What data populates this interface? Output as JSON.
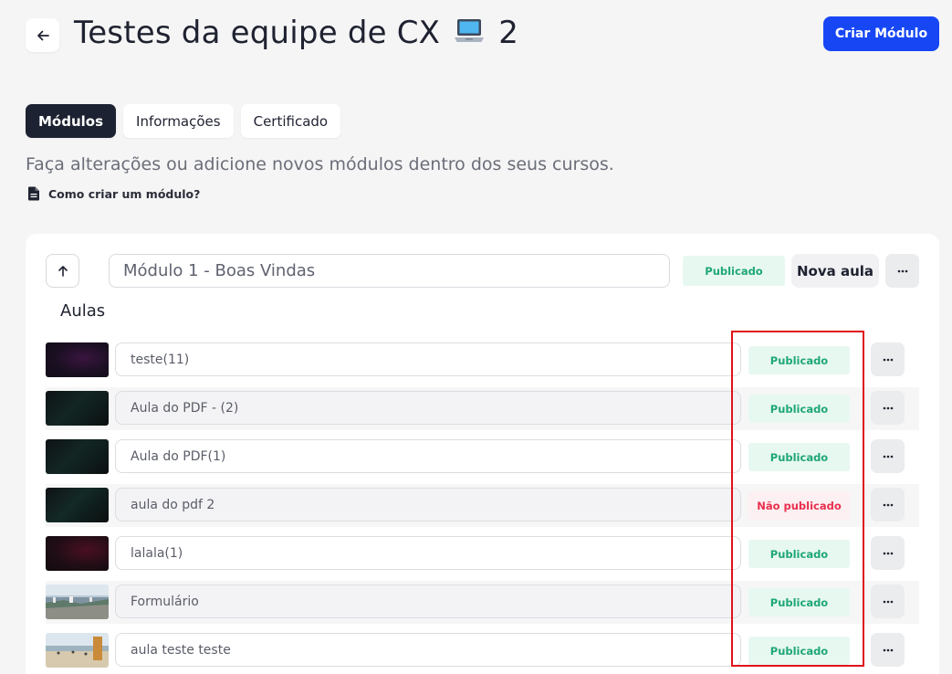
{
  "header": {
    "back_icon": "arrow-left-icon",
    "title_prefix": "Testes da equipe de CX",
    "title_emoji": "laptop-icon",
    "title_suffix": "2",
    "create_module_label": "Criar Módulo",
    "accent_color": "#1747f5"
  },
  "tabs": [
    {
      "label": "Módulos",
      "active": true
    },
    {
      "label": "Informações",
      "active": false
    },
    {
      "label": "Certificado",
      "active": false
    }
  ],
  "subtitle": "Faça alterações ou adicione novos módulos dentro dos seus cursos.",
  "help_link": {
    "icon": "document-icon",
    "label": "Como criar um módulo?"
  },
  "module": {
    "up_icon": "arrow-up-icon",
    "name": "Módulo 1 - Boas Vindas",
    "status": "Publicado",
    "new_lesson_label": "Nova aula",
    "more_icon": "more-horizontal-icon",
    "lessons_label": "Aulas"
  },
  "lessons": [
    {
      "title": "teste(11)",
      "status": "Publicado",
      "published": true,
      "thumb": "dark-purple"
    },
    {
      "title": "Aula do PDF - (2)",
      "status": "Publicado",
      "published": true,
      "thumb": "dark-teal"
    },
    {
      "title": "Aula do PDF(1)",
      "status": "Publicado",
      "published": true,
      "thumb": "dark-teal"
    },
    {
      "title": "aula do pdf 2",
      "status": "Não publicado",
      "published": false,
      "thumb": "dark-teal"
    },
    {
      "title": "lalala(1)",
      "status": "Publicado",
      "published": true,
      "thumb": "dark-red"
    },
    {
      "title": "Formulário",
      "status": "Publicado",
      "published": true,
      "thumb": "city-photo"
    },
    {
      "title": "aula teste teste",
      "status": "Publicado",
      "published": true,
      "thumb": "beach-photo"
    }
  ],
  "colors": {
    "published_bg": "#e7f8f1",
    "published_text": "#1fa776",
    "unpublished_bg": "#fdf0f2",
    "unpublished_text": "#e8304e",
    "highlight": "#e0121b"
  }
}
